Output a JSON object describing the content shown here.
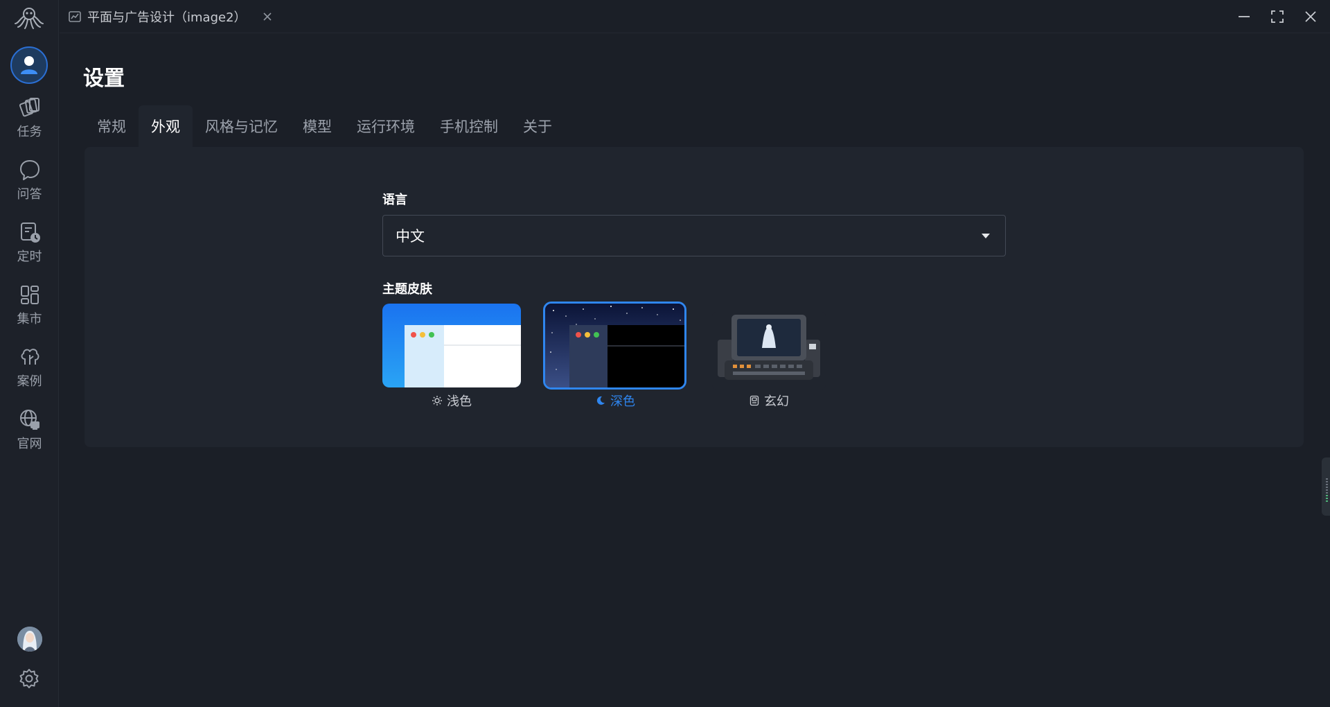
{
  "window": {
    "tab_title": "平面与广告设计（image2）"
  },
  "sidebar": {
    "items": [
      {
        "label": "任务",
        "icon": "tasks-icon"
      },
      {
        "label": "问答",
        "icon": "chat-icon"
      },
      {
        "label": "定时",
        "icon": "schedule-icon"
      },
      {
        "label": "集市",
        "icon": "market-icon"
      },
      {
        "label": "案例",
        "icon": "cases-icon"
      },
      {
        "label": "官网",
        "icon": "website-icon"
      }
    ]
  },
  "page": {
    "title": "设置",
    "tabs": [
      {
        "label": "常规"
      },
      {
        "label": "外观",
        "active": true
      },
      {
        "label": "风格与记忆"
      },
      {
        "label": "模型"
      },
      {
        "label": "运行环境"
      },
      {
        "label": "手机控制"
      },
      {
        "label": "关于"
      }
    ]
  },
  "appearance": {
    "language_label": "语言",
    "language_value": "中文",
    "theme_label": "主题皮肤",
    "themes": [
      {
        "label": "浅色",
        "icon": "sun-icon",
        "selected": false
      },
      {
        "label": "深色",
        "icon": "moon-icon",
        "selected": true
      },
      {
        "label": "玄幻",
        "icon": "robot-icon",
        "selected": false
      }
    ]
  },
  "colors": {
    "accent": "#2f86ef",
    "background": "#1b1f27",
    "panel": "#20252e",
    "sidebar": "#1d2129"
  }
}
